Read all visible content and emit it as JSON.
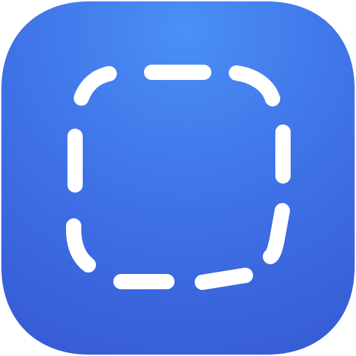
{
  "icon": {
    "name": "dashed-rounded-square-icon",
    "background_gradient": {
      "top": "#4a8ff7",
      "mid": "#3f72e6",
      "bottom": "#3557d1"
    },
    "glyph_color": "#ffffff"
  }
}
